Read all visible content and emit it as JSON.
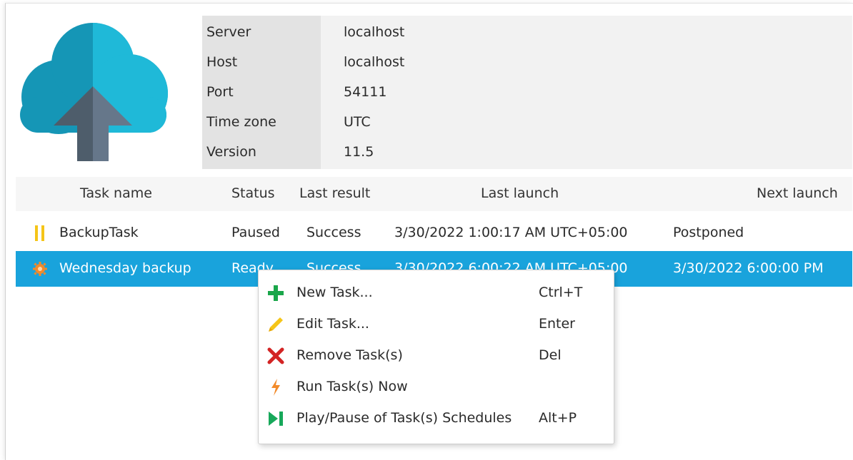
{
  "server_info": {
    "rows": [
      {
        "key": "Server",
        "value": "localhost"
      },
      {
        "key": "Host",
        "value": "localhost"
      },
      {
        "key": "Port",
        "value": "54111"
      },
      {
        "key": "Time zone",
        "value": "UTC"
      },
      {
        "key": "Version",
        "value": "11.5"
      }
    ]
  },
  "grid": {
    "columns": [
      "Task name",
      "Status",
      "Last result",
      "Last launch",
      "Next launch"
    ],
    "rows": [
      {
        "icon": "pause-icon",
        "name": "BackupTask",
        "status": "Paused",
        "last_result": "Success",
        "last_launch": "3/30/2022 1:00:17 AM UTC+05:00",
        "next_launch": "Postponed"
      },
      {
        "icon": "gear-icon",
        "name": "Wednesday backup",
        "status": "Ready",
        "last_result": "Success",
        "last_launch": "3/30/2022 6:00:22 AM UTC+05:00",
        "next_launch": "3/30/2022 6:00:00 PM"
      }
    ]
  },
  "context_menu": {
    "items": [
      {
        "label": "New Task...",
        "shortcut": "Ctrl+T",
        "icon": "plus-icon"
      },
      {
        "label": "Edit Task...",
        "shortcut": "Enter",
        "icon": "pencil-icon"
      },
      {
        "label": "Remove Task(s)",
        "shortcut": "Del",
        "icon": "close-icon"
      },
      {
        "label": "Run Task(s) Now",
        "shortcut": "",
        "icon": "lightning-icon"
      },
      {
        "label": "Play/Pause of Task(s) Schedules",
        "shortcut": "Alt+P",
        "icon": "play-pause-icon"
      }
    ]
  },
  "colors": {
    "selection": "#19a3dc",
    "cloud_light": "#1fb9d8",
    "cloud_dark": "#1596b6",
    "arrow": "#5a6a78",
    "pause": "#f5c518",
    "gear": "#f28a2a",
    "plus": "#1aa64a",
    "pencil": "#f5c518",
    "remove": "#d32424",
    "lightning": "#f28a2a",
    "play_pause": "#17a85a"
  }
}
